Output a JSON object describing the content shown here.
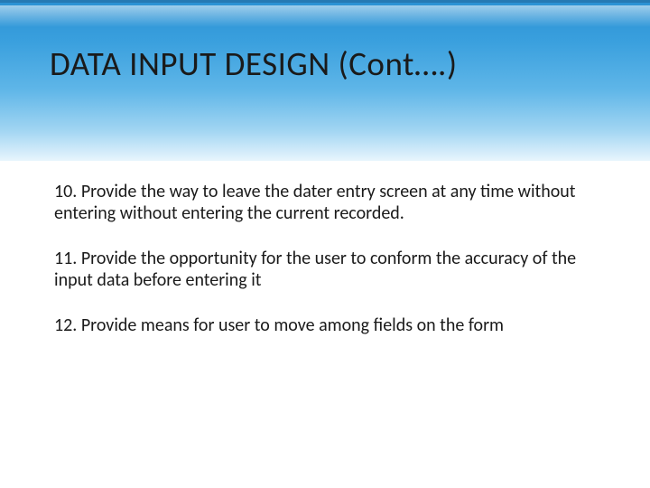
{
  "slide": {
    "title": "DATA INPUT DESIGN (Cont….)",
    "paragraphs": [
      "10. Provide the way to leave the dater entry screen at any time without entering without entering the current recorded.",
      "11. Provide the opportunity for  the user to conform the accuracy of the  input data before entering it",
      "12. Provide means for user to move among fields on the form"
    ]
  }
}
